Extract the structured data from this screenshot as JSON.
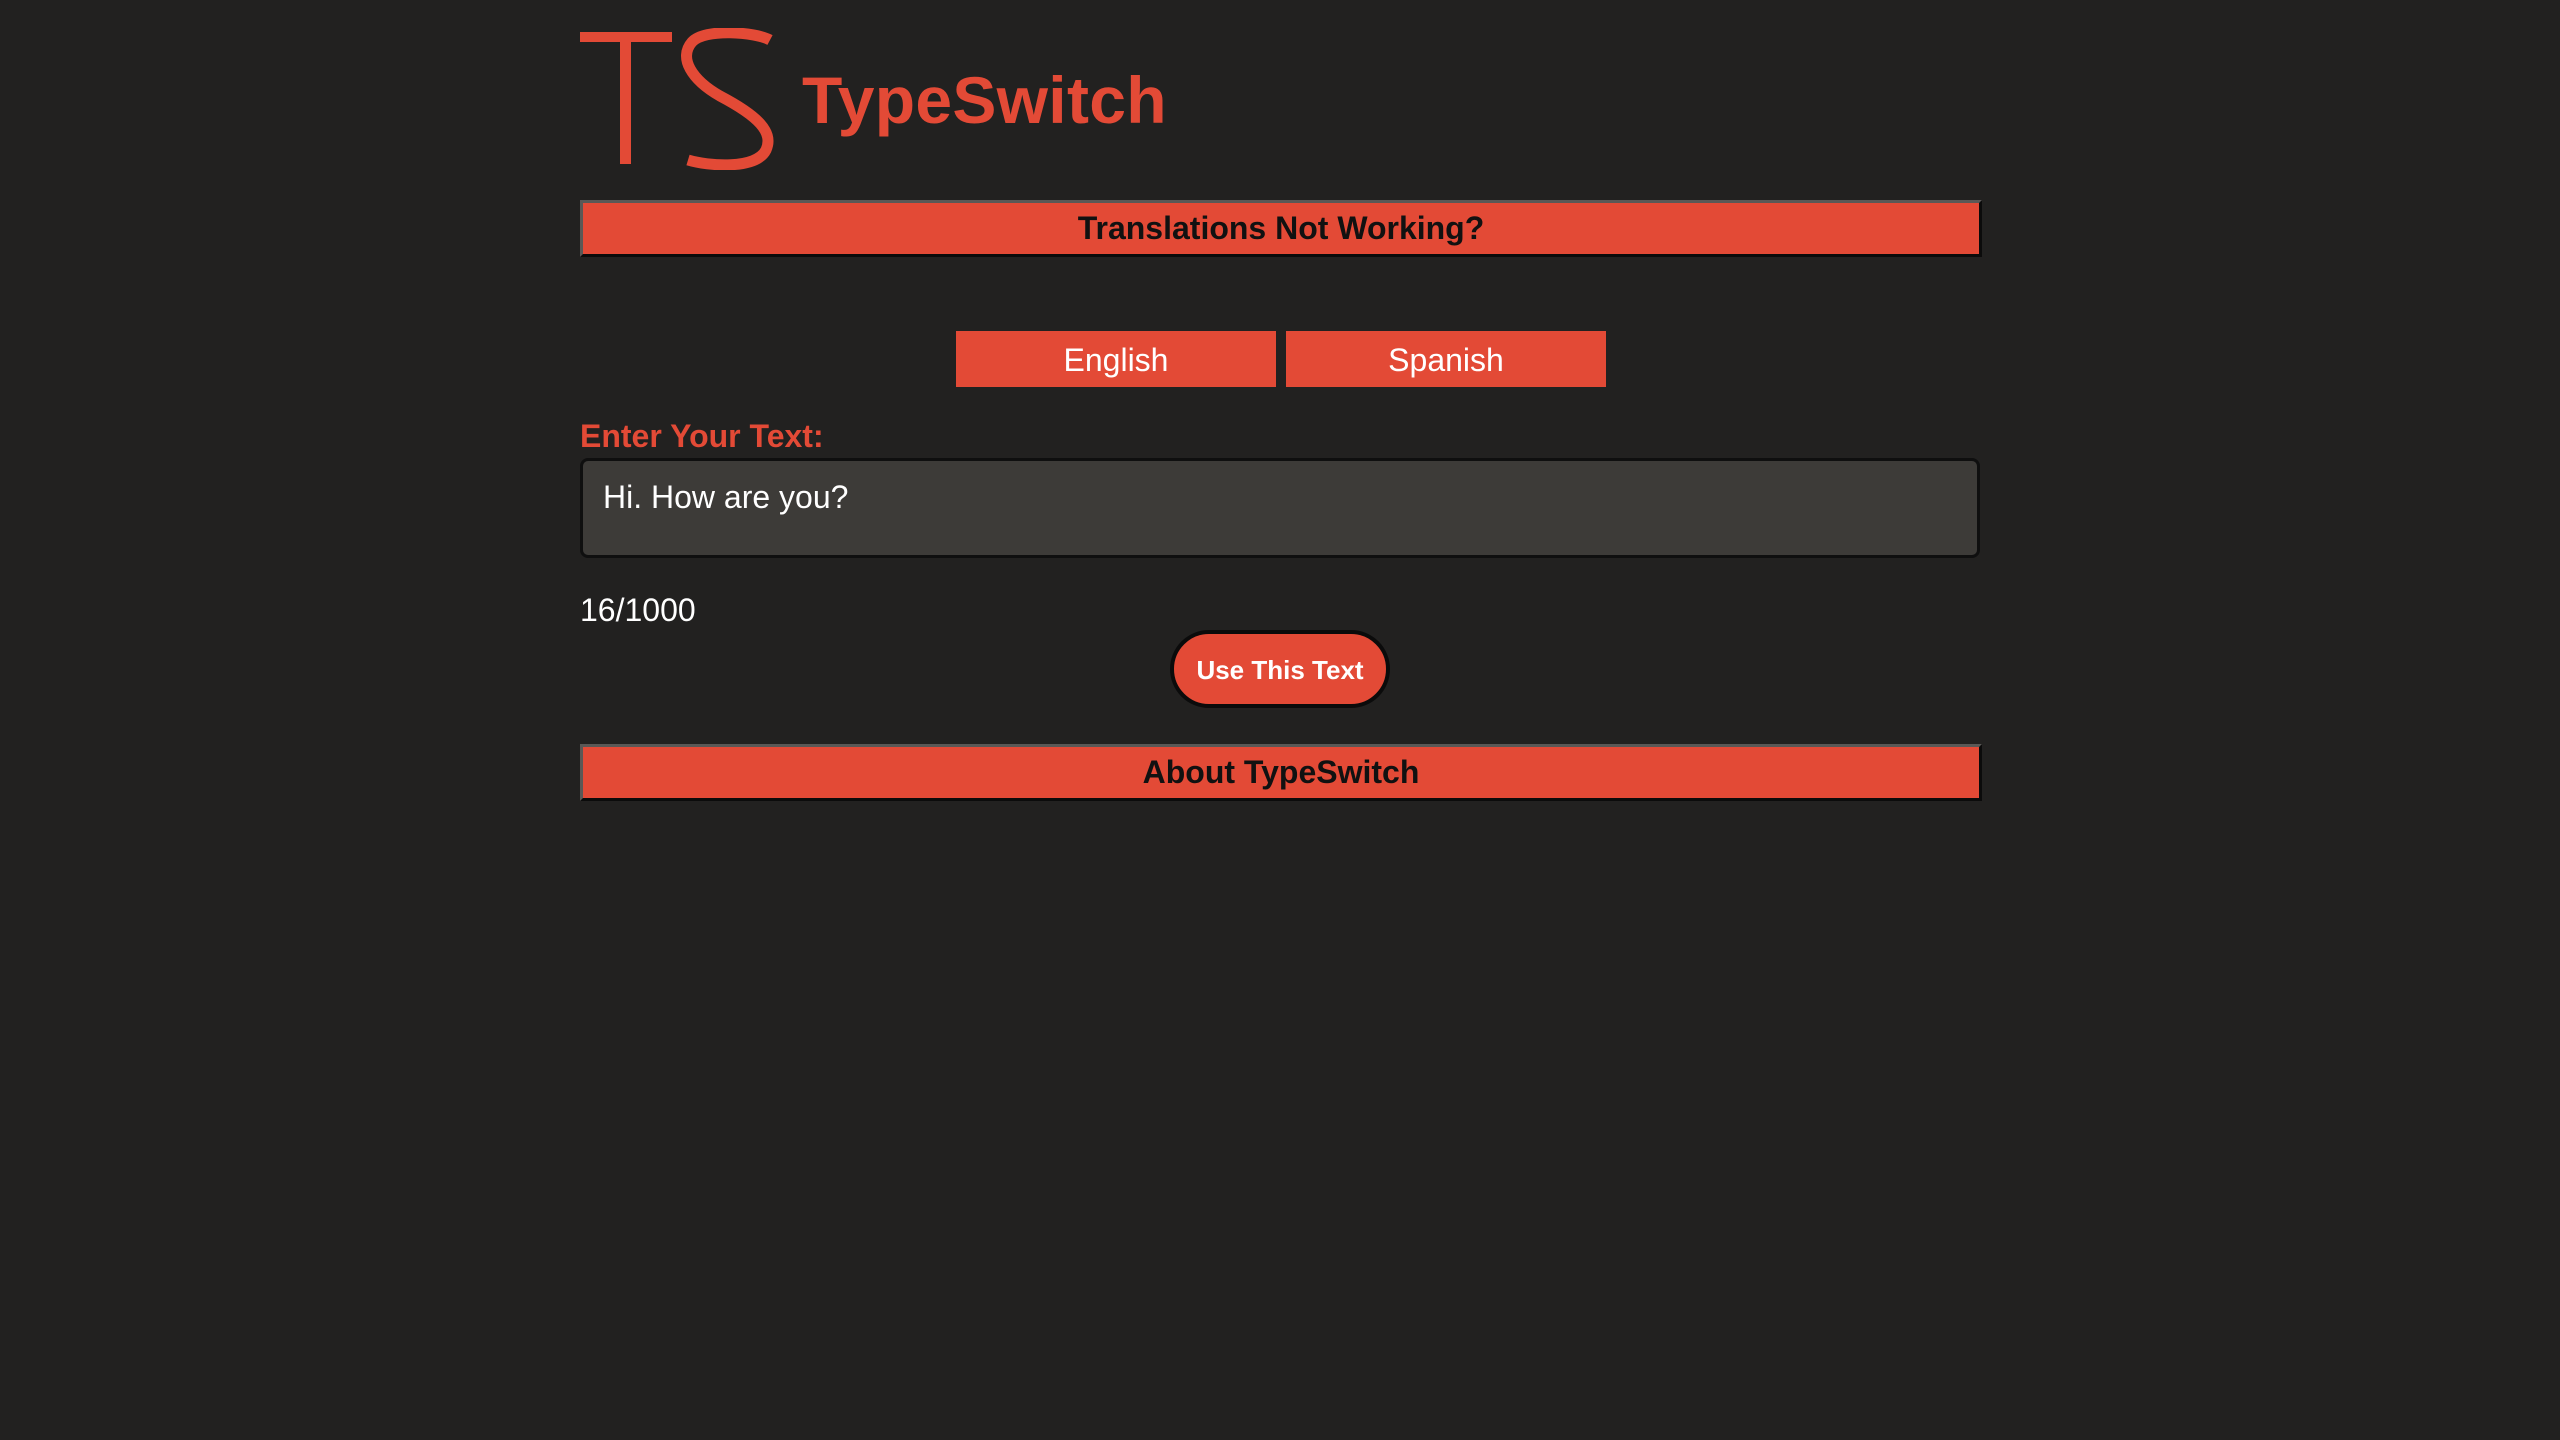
{
  "brand": {
    "logo_letters": "TS",
    "name": "TypeSwitch",
    "accent_color": "#e34a36"
  },
  "banners": {
    "top_label": "Translations Not Working?",
    "bottom_label": "About TypeSwitch"
  },
  "languages": {
    "options": [
      {
        "label": "English"
      },
      {
        "label": "Spanish"
      }
    ]
  },
  "input": {
    "label": "Enter Your Text:",
    "value": "Hi. How are you?",
    "char_count": "16/1000"
  },
  "actions": {
    "use_text_label": "Use This Text"
  }
}
